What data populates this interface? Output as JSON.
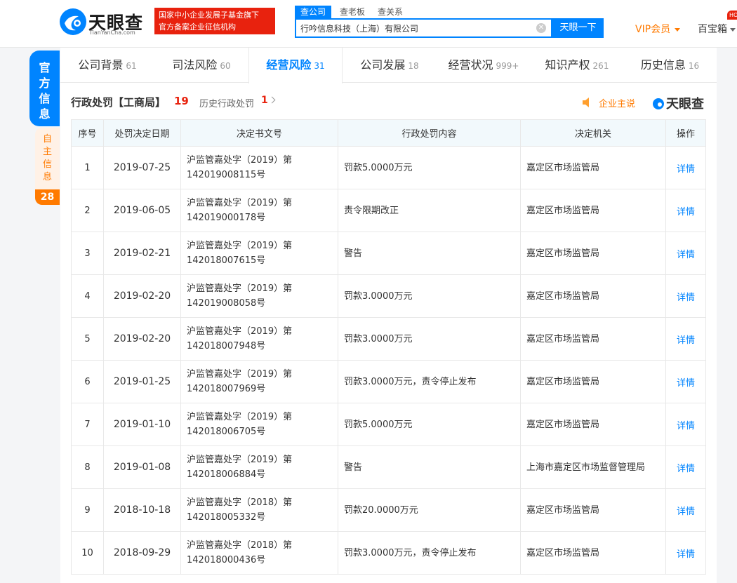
{
  "header": {
    "logo_name": "天眼查",
    "logo_sub": "TianYanCha.com",
    "slogan_line1": "国家中小企业发展子基金旗下",
    "slogan_line2": "官方备案企业征信机构",
    "search_tabs": [
      "查公司",
      "查老板",
      "查关系"
    ],
    "search_value": "行吟信息科技（上海）有限公司",
    "search_button": "天眼一下",
    "vip_label": "VIP会员",
    "baobao_label": "百宝箱",
    "hot_badge": "HOT"
  },
  "side": {
    "official": [
      "官",
      "方",
      "信",
      "息"
    ],
    "self": [
      "自",
      "主",
      "信",
      "息"
    ],
    "self_count": "28"
  },
  "nav": {
    "tabs": [
      {
        "label": "公司背景",
        "count": "61"
      },
      {
        "label": "司法风险",
        "count": "60"
      },
      {
        "label": "经营风险",
        "count": "31"
      },
      {
        "label": "公司发展",
        "count": "18"
      },
      {
        "label": "经营状况",
        "count": "999+"
      },
      {
        "label": "知识产权",
        "count": "261"
      },
      {
        "label": "历史信息",
        "count": "16"
      }
    ]
  },
  "section": {
    "title": "行政处罚【工商局】",
    "count": "19",
    "history_label": "历史行政处罚",
    "history_count": "1",
    "corp_say": "企业主说",
    "brand": "天眼查"
  },
  "table": {
    "headers": [
      "序号",
      "处罚决定日期",
      "决定书文号",
      "行政处罚内容",
      "决定机关",
      "操作"
    ],
    "rows": [
      {
        "no": "1",
        "date": "2019-07-25",
        "doc1": "沪监管嘉处字（2019）第",
        "doc2": "142019008115号",
        "content": "罚款5.0000万元",
        "org": "嘉定区市场监管局",
        "op": "详情"
      },
      {
        "no": "2",
        "date": "2019-06-05",
        "doc1": "沪监管嘉处字（2019）第",
        "doc2": "142019000178号",
        "content": "责令限期改正",
        "org": "嘉定区市场监管局",
        "op": "详情"
      },
      {
        "no": "3",
        "date": "2019-02-21",
        "doc1": "沪监管嘉处字（2019）第",
        "doc2": "142018007615号",
        "content": "警告",
        "org": "嘉定区市场监管局",
        "op": "详情"
      },
      {
        "no": "4",
        "date": "2019-02-20",
        "doc1": "沪监管嘉处字（2019）第",
        "doc2": "142019008058号",
        "content": "罚款3.0000万元",
        "org": "嘉定区市场监管局",
        "op": "详情"
      },
      {
        "no": "5",
        "date": "2019-02-20",
        "doc1": "沪监管嘉处字（2019）第",
        "doc2": "142018007948号",
        "content": "罚款3.0000万元",
        "org": "嘉定区市场监管局",
        "op": "详情"
      },
      {
        "no": "6",
        "date": "2019-01-25",
        "doc1": "沪监管嘉处字（2019）第",
        "doc2": "142018007969号",
        "content": "罚款3.0000万元，责令停止发布",
        "org": "嘉定区市场监管局",
        "op": "详情"
      },
      {
        "no": "7",
        "date": "2019-01-10",
        "doc1": "沪监管嘉处字（2019）第",
        "doc2": "142018006705号",
        "content": "罚款5.0000万元",
        "org": "嘉定区市场监管局",
        "op": "详情"
      },
      {
        "no": "8",
        "date": "2019-01-08",
        "doc1": "沪监管嘉处字（2019）第",
        "doc2": "142018006884号",
        "content": "警告",
        "org": "上海市嘉定区市场监督管理局",
        "op": "详情"
      },
      {
        "no": "9",
        "date": "2018-10-18",
        "doc1": "沪监管嘉处字（2018）第",
        "doc2": "142018005332号",
        "content": "罚款20.0000万元",
        "org": "嘉定区市场监管局",
        "op": "详情"
      },
      {
        "no": "10",
        "date": "2018-09-29",
        "doc1": "沪监管嘉处字（2018）第",
        "doc2": "142018000436号",
        "content": "罚款3.0000万元，责令停止发布",
        "org": "嘉定区市场监管局",
        "op": "详情"
      }
    ]
  },
  "colors": {
    "accent": "#0084ff",
    "red": "#e8220e",
    "orange": "#ff7a00"
  }
}
